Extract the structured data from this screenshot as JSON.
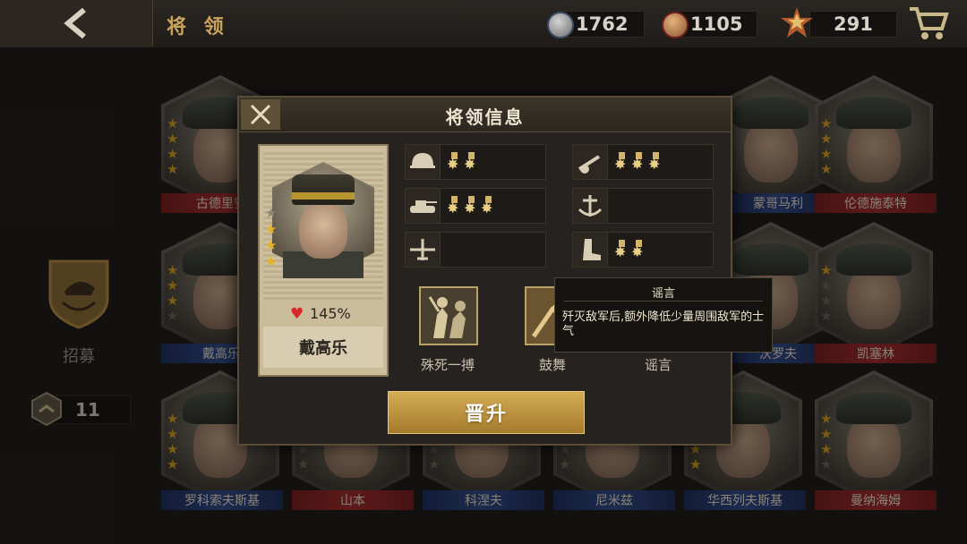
{
  "header": {
    "title": "将 领",
    "resources": [
      {
        "icon": "silver-medal-icon",
        "value": "1762"
      },
      {
        "icon": "bronze-medal-icon",
        "value": "1105"
      },
      {
        "icon": "star-badge-icon",
        "value": "291"
      }
    ]
  },
  "sidebar": {
    "recruit_label": "招募",
    "token_count": "11"
  },
  "generals": [
    {
      "name": "古德里安",
      "stars": 4,
      "band": "red"
    },
    {
      "name": "蒙哥马利",
      "stars": 0,
      "band": "blue"
    },
    {
      "name": "伦德施泰特",
      "stars": 4,
      "band": "red"
    },
    {
      "name": "戴高乐",
      "stars": 3,
      "band": "blue"
    },
    {
      "name": "沃罗夫",
      "stars": 0,
      "band": "blue"
    },
    {
      "name": "凯塞林",
      "stars": 1,
      "band": "red"
    },
    {
      "name": "罗科索夫斯基",
      "stars": 4,
      "band": "blue"
    },
    {
      "name": "山本",
      "stars": 2,
      "band": "red"
    },
    {
      "name": "科涅夫",
      "stars": 1,
      "band": "blue"
    },
    {
      "name": "尼米兹",
      "stars": 2,
      "band": "blue"
    },
    {
      "name": "华西列夫斯基",
      "stars": 4,
      "band": "blue"
    },
    {
      "name": "曼纳海姆",
      "stars": 3,
      "band": "red"
    }
  ],
  "modal": {
    "title": "将领信息",
    "general_name": "戴高乐",
    "stars": 3,
    "stat_percent": "145%",
    "skill_rows": [
      {
        "icon": "helmet-icon",
        "medals": 2
      },
      {
        "icon": "artillery-icon",
        "medals": 3
      },
      {
        "icon": "tank-icon",
        "medals": 3
      },
      {
        "icon": "anchor-icon",
        "medals": 0
      },
      {
        "icon": "plane-icon",
        "medals": 0
      },
      {
        "icon": "boot-icon",
        "medals": 2
      }
    ],
    "skills": [
      {
        "icon": "soldiers-icon",
        "label": "殊死一搏"
      },
      {
        "icon": "bugle-icon",
        "label": "鼓舞"
      },
      {
        "icon": "rumor-icon",
        "label": "谣言"
      }
    ],
    "tooltip": {
      "title": "谣言",
      "text": "歼灭敌军后,额外降低少量周围敌军的士气"
    },
    "promote_label": "晋升"
  },
  "colors": {
    "gold": "#c9a45a",
    "red_band": "#a42a2a",
    "blue_band": "#2d4a8c"
  }
}
